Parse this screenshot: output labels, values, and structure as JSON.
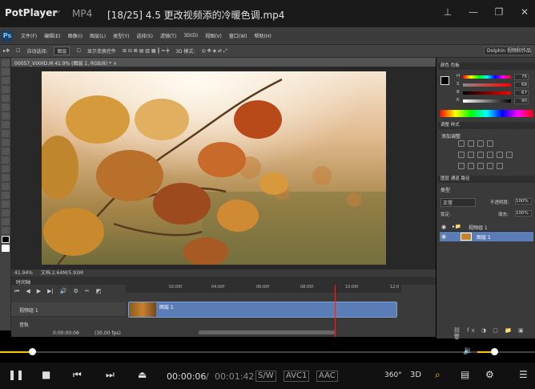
{
  "potplayer": {
    "logo": "PotPlayer",
    "logo_arrow": "﹀",
    "format": "MP4",
    "file_title": "[18/25] 4.5 更改视频添的冷暖色调.mp4",
    "window_controls": [
      "pin-icon",
      "minimize-icon",
      "restore-icon",
      "close-icon"
    ],
    "time_current": "00:00:06",
    "time_separator": "/",
    "time_total": "00:01:42",
    "tags": [
      "S/W",
      "AVC1",
      "AAC"
    ],
    "tag_360": "360°",
    "tag_3d": "3D",
    "seek_progress": 0.06,
    "volume_level": 0.33,
    "colors": {
      "accent": "#ffc400"
    }
  },
  "photoshop": {
    "logo": "Ps",
    "menu": [
      "文件(F)",
      "编辑(E)",
      "图像(I)",
      "图层(L)",
      "类型(Y)",
      "选择(S)",
      "滤镜(T)",
      "3D(D)",
      "视图(V)",
      "窗口(W)",
      "帮助(H)"
    ],
    "options": {
      "auto_select": "自动选择:",
      "auto_select_value": "图层",
      "show_transform": "显示变换控件",
      "mode_3d": "3D 模式:"
    },
    "workspace": "Dolphin 视频和作品",
    "doc_tab": "00057_VIXHD.M 41.9% (图层 1, RGB/8) * ×",
    "status_zoom": "41.94%",
    "status_doc": "文档:2.64M/5.93M",
    "timeline": {
      "panel_title": "时间轴",
      "ruler_ticks": [
        "02:00f",
        "04:00f",
        "06:00f",
        "08:00f",
        "10:00f",
        "12:0"
      ],
      "track_name": "视频组 1",
      "audio_name": "音轨",
      "clip_label": "图层 1",
      "time": "0:00:00:06",
      "fps": "(30.00 fps)"
    },
    "color_panel": {
      "tabs": "颜色 色板",
      "H": "H",
      "H_val": "75",
      "S": "S",
      "S_val": "68",
      "B": "B",
      "B_val": "67",
      "K": "K",
      "K_val": "90"
    },
    "adjustments": {
      "tabs": "调整 样式",
      "title": "添加调整"
    },
    "layers": {
      "tabs": "图层 通道 路径",
      "kind": "类型",
      "blend": "正常",
      "opacity_label": "不透明度:",
      "opacity": "100%",
      "lock_label": "锁定:",
      "fill_label": "填充:",
      "fill": "100%",
      "group_name": "视频组 1",
      "layer_name": "图层 1"
    }
  }
}
